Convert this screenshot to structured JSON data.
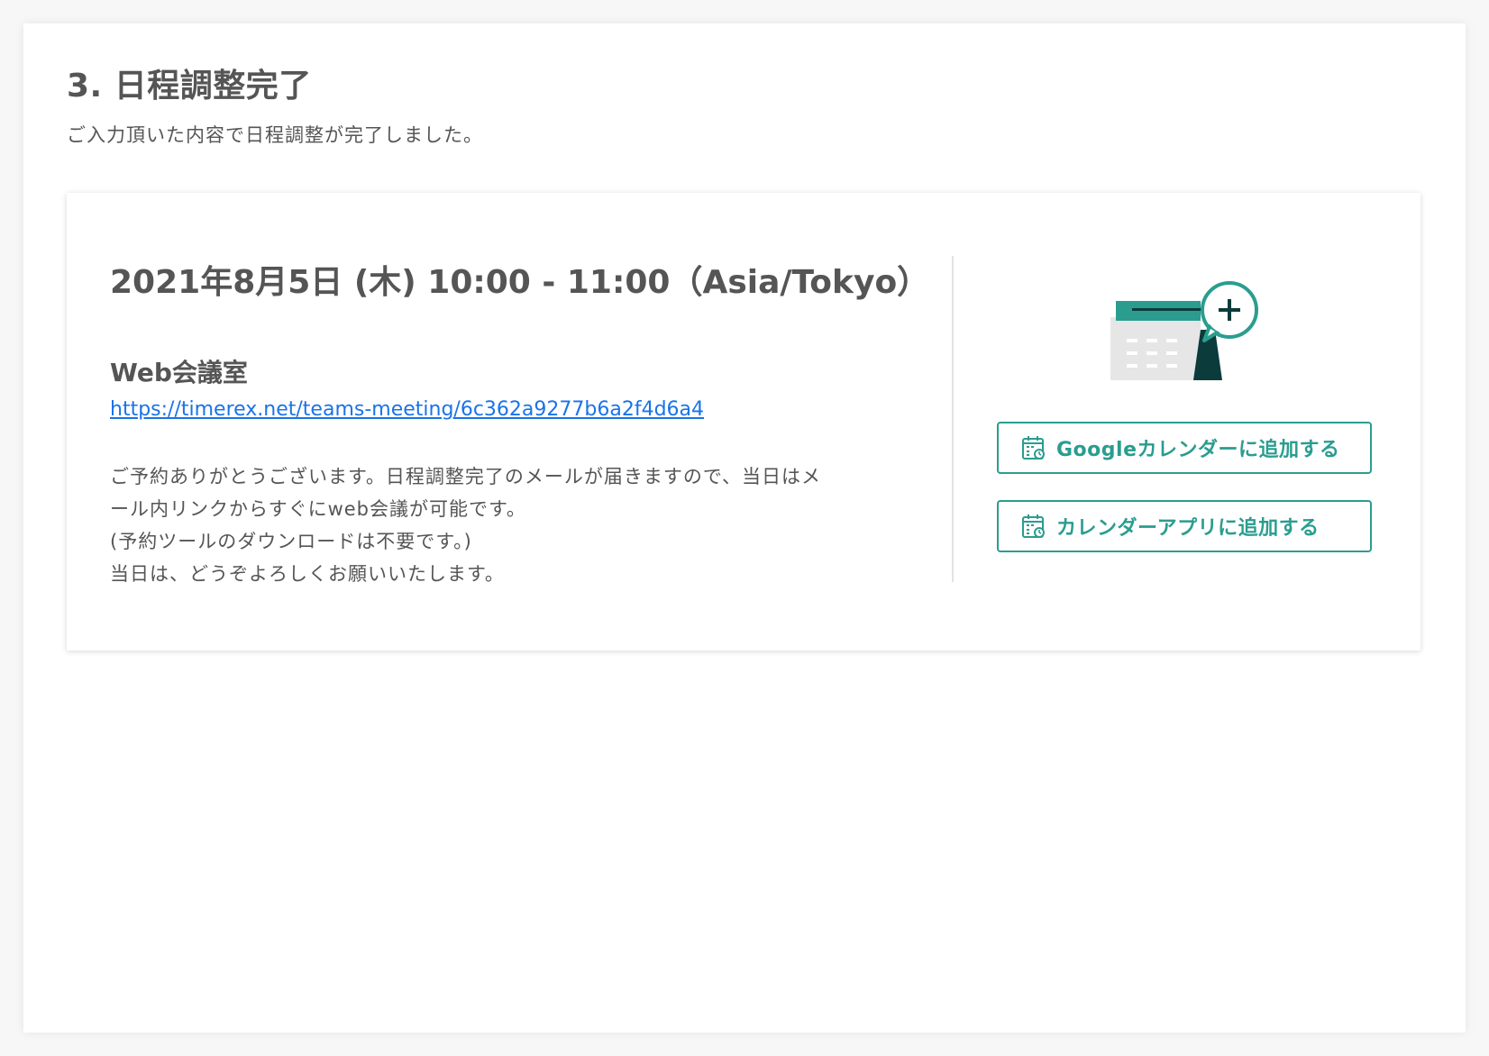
{
  "header": {
    "title": "3. 日程調整完了",
    "subtitle": "ご入力頂いた内容で日程調整が完了しました。"
  },
  "booking": {
    "datetime": "2021年8月5日 (木) 10:00 - 11:00（Asia/Tokyo）",
    "meeting_room_label": "Web会議室",
    "meeting_url": "https://timerex.net/teams-meeting/6c362a9277b6a2f4d6a4",
    "message_lines": [
      "ご予約ありがとうございます。日程調整完了のメールが届きますので、当日はメ",
      "ール内リンクからすぐにweb会議が可能です。",
      "(予約ツールのダウンロードは不要です。)",
      "当日は、どうぞよろしくお願いいたします。"
    ]
  },
  "actions": {
    "google_calendar_label": "Googleカレンダーに追加する",
    "calendar_app_label": "カレンダーアプリに追加する"
  },
  "icons": {
    "illustration": "calendar-add-illustration",
    "button_icon": "calendar-icon"
  },
  "colors": {
    "accent": "#2a9d8f",
    "link": "#1a73e8",
    "text": "#555555",
    "dark_teal": "#0b3b3b"
  }
}
